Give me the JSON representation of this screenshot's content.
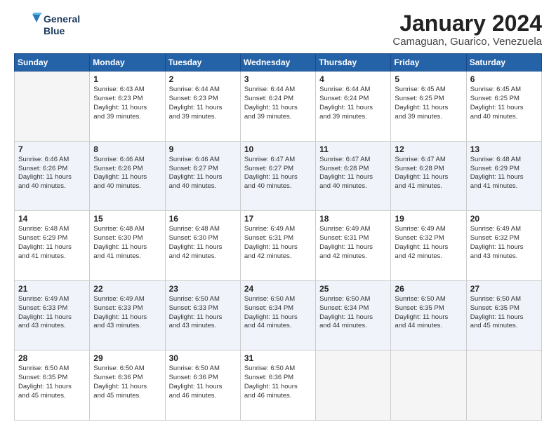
{
  "logo": {
    "line1": "General",
    "line2": "Blue"
  },
  "title": "January 2024",
  "subtitle": "Camaguan, Guarico, Venezuela",
  "header_days": [
    "Sunday",
    "Monday",
    "Tuesday",
    "Wednesday",
    "Thursday",
    "Friday",
    "Saturday"
  ],
  "weeks": [
    [
      {
        "day": "",
        "info": ""
      },
      {
        "day": "1",
        "info": "Sunrise: 6:43 AM\nSunset: 6:23 PM\nDaylight: 11 hours\nand 39 minutes."
      },
      {
        "day": "2",
        "info": "Sunrise: 6:44 AM\nSunset: 6:23 PM\nDaylight: 11 hours\nand 39 minutes."
      },
      {
        "day": "3",
        "info": "Sunrise: 6:44 AM\nSunset: 6:24 PM\nDaylight: 11 hours\nand 39 minutes."
      },
      {
        "day": "4",
        "info": "Sunrise: 6:44 AM\nSunset: 6:24 PM\nDaylight: 11 hours\nand 39 minutes."
      },
      {
        "day": "5",
        "info": "Sunrise: 6:45 AM\nSunset: 6:25 PM\nDaylight: 11 hours\nand 39 minutes."
      },
      {
        "day": "6",
        "info": "Sunrise: 6:45 AM\nSunset: 6:25 PM\nDaylight: 11 hours\nand 40 minutes."
      }
    ],
    [
      {
        "day": "7",
        "info": "Sunrise: 6:46 AM\nSunset: 6:26 PM\nDaylight: 11 hours\nand 40 minutes."
      },
      {
        "day": "8",
        "info": "Sunrise: 6:46 AM\nSunset: 6:26 PM\nDaylight: 11 hours\nand 40 minutes."
      },
      {
        "day": "9",
        "info": "Sunrise: 6:46 AM\nSunset: 6:27 PM\nDaylight: 11 hours\nand 40 minutes."
      },
      {
        "day": "10",
        "info": "Sunrise: 6:47 AM\nSunset: 6:27 PM\nDaylight: 11 hours\nand 40 minutes."
      },
      {
        "day": "11",
        "info": "Sunrise: 6:47 AM\nSunset: 6:28 PM\nDaylight: 11 hours\nand 40 minutes."
      },
      {
        "day": "12",
        "info": "Sunrise: 6:47 AM\nSunset: 6:28 PM\nDaylight: 11 hours\nand 41 minutes."
      },
      {
        "day": "13",
        "info": "Sunrise: 6:48 AM\nSunset: 6:29 PM\nDaylight: 11 hours\nand 41 minutes."
      }
    ],
    [
      {
        "day": "14",
        "info": "Sunrise: 6:48 AM\nSunset: 6:29 PM\nDaylight: 11 hours\nand 41 minutes."
      },
      {
        "day": "15",
        "info": "Sunrise: 6:48 AM\nSunset: 6:30 PM\nDaylight: 11 hours\nand 41 minutes."
      },
      {
        "day": "16",
        "info": "Sunrise: 6:48 AM\nSunset: 6:30 PM\nDaylight: 11 hours\nand 42 minutes."
      },
      {
        "day": "17",
        "info": "Sunrise: 6:49 AM\nSunset: 6:31 PM\nDaylight: 11 hours\nand 42 minutes."
      },
      {
        "day": "18",
        "info": "Sunrise: 6:49 AM\nSunset: 6:31 PM\nDaylight: 11 hours\nand 42 minutes."
      },
      {
        "day": "19",
        "info": "Sunrise: 6:49 AM\nSunset: 6:32 PM\nDaylight: 11 hours\nand 42 minutes."
      },
      {
        "day": "20",
        "info": "Sunrise: 6:49 AM\nSunset: 6:32 PM\nDaylight: 11 hours\nand 43 minutes."
      }
    ],
    [
      {
        "day": "21",
        "info": "Sunrise: 6:49 AM\nSunset: 6:33 PM\nDaylight: 11 hours\nand 43 minutes."
      },
      {
        "day": "22",
        "info": "Sunrise: 6:49 AM\nSunset: 6:33 PM\nDaylight: 11 hours\nand 43 minutes."
      },
      {
        "day": "23",
        "info": "Sunrise: 6:50 AM\nSunset: 6:33 PM\nDaylight: 11 hours\nand 43 minutes."
      },
      {
        "day": "24",
        "info": "Sunrise: 6:50 AM\nSunset: 6:34 PM\nDaylight: 11 hours\nand 44 minutes."
      },
      {
        "day": "25",
        "info": "Sunrise: 6:50 AM\nSunset: 6:34 PM\nDaylight: 11 hours\nand 44 minutes."
      },
      {
        "day": "26",
        "info": "Sunrise: 6:50 AM\nSunset: 6:35 PM\nDaylight: 11 hours\nand 44 minutes."
      },
      {
        "day": "27",
        "info": "Sunrise: 6:50 AM\nSunset: 6:35 PM\nDaylight: 11 hours\nand 45 minutes."
      }
    ],
    [
      {
        "day": "28",
        "info": "Sunrise: 6:50 AM\nSunset: 6:35 PM\nDaylight: 11 hours\nand 45 minutes."
      },
      {
        "day": "29",
        "info": "Sunrise: 6:50 AM\nSunset: 6:36 PM\nDaylight: 11 hours\nand 45 minutes."
      },
      {
        "day": "30",
        "info": "Sunrise: 6:50 AM\nSunset: 6:36 PM\nDaylight: 11 hours\nand 46 minutes."
      },
      {
        "day": "31",
        "info": "Sunrise: 6:50 AM\nSunset: 6:36 PM\nDaylight: 11 hours\nand 46 minutes."
      },
      {
        "day": "",
        "info": ""
      },
      {
        "day": "",
        "info": ""
      },
      {
        "day": "",
        "info": ""
      }
    ]
  ]
}
